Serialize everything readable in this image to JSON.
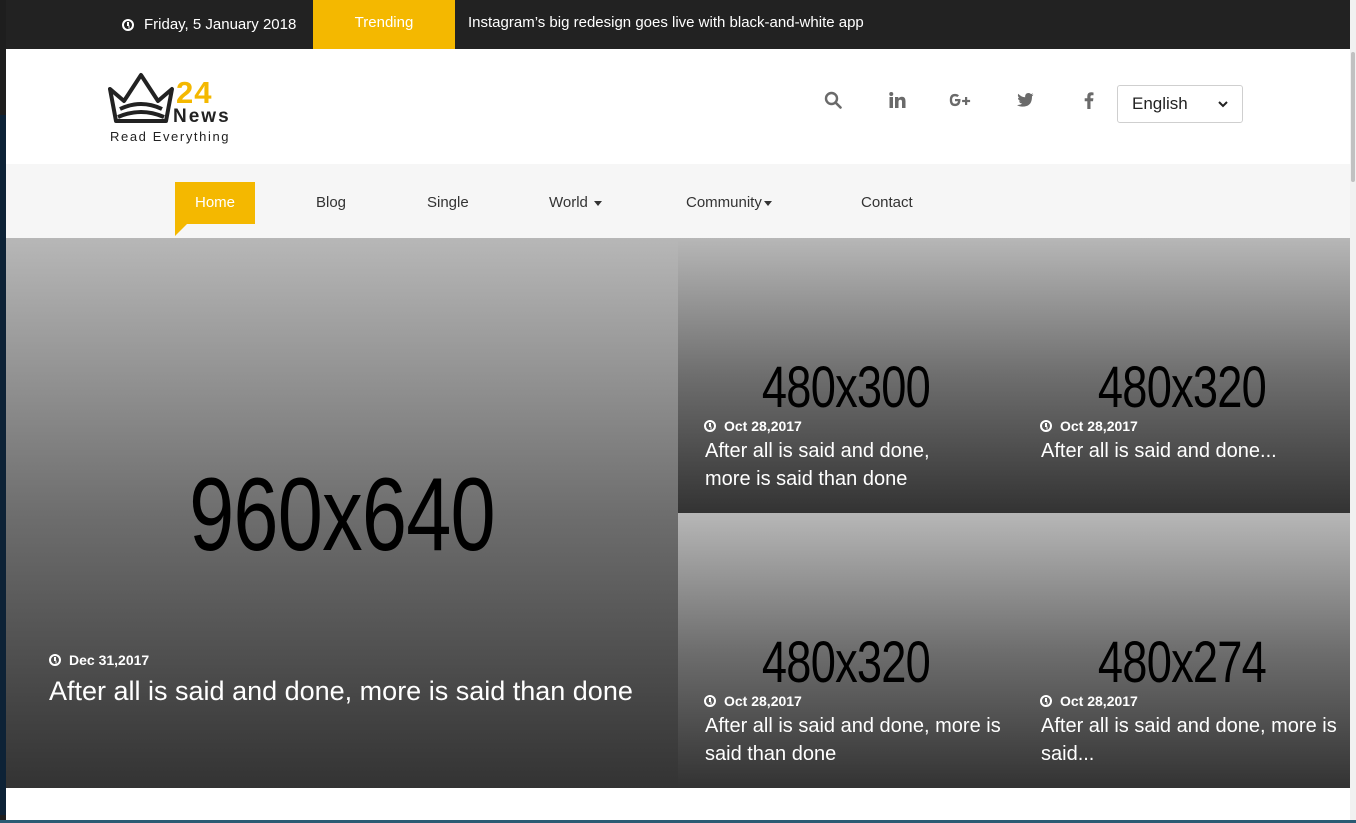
{
  "topbar": {
    "date": "Friday, 5 January 2018",
    "trending_label": "Trending",
    "headline": "Instagram’s big redesign goes live with black-and-white app"
  },
  "logo": {
    "number": "24",
    "name": "News",
    "tagline": "Read Everything"
  },
  "header": {
    "socials": [
      "search-icon",
      "linkedin-icon",
      "google-plus-icon",
      "twitter-icon",
      "facebook-icon"
    ],
    "language": "English"
  },
  "nav": {
    "items": [
      "Home",
      "Blog",
      "Single",
      "World",
      "Community",
      "Contact"
    ]
  },
  "hero": {
    "main": {
      "placeholder": "960x640",
      "date": "Dec 31,2017",
      "title": "After all is said and done, more is said than done"
    },
    "cards": [
      {
        "placeholder": "480x300",
        "date": "Oct 28,2017",
        "title": "After all is said and done, more is said than done"
      },
      {
        "placeholder": "480x320",
        "date": "Oct 28,2017",
        "title": "After all is said and done..."
      },
      {
        "placeholder": "480x320",
        "date": "Oct 28,2017",
        "title": "After all is said and done, more is said than done"
      },
      {
        "placeholder": "480x274",
        "date": "Oct 28,2017",
        "title": "After all is said and done, more is said..."
      }
    ]
  },
  "colors": {
    "accent": "#f4b800",
    "topbar": "#222222",
    "nav_bg": "#f6f6f6"
  }
}
